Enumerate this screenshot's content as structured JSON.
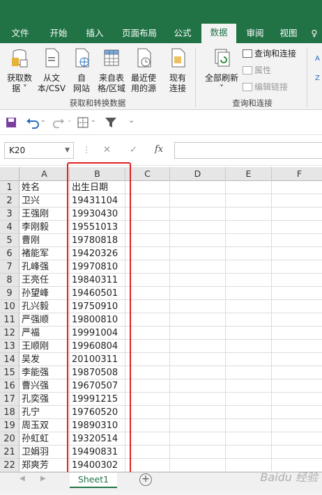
{
  "ribbon_tabs": [
    "文件",
    "开始",
    "插入",
    "页面布局",
    "公式",
    "数据",
    "审阅",
    "视图"
  ],
  "active_tab": "数据",
  "ribbon": {
    "get_data_label_line1": "获取数",
    "get_data_label_line2": "据 ˅",
    "from_text_line1": "从文",
    "from_text_line2": "本/CSV",
    "from_web_line1": "自",
    "from_web_line2": "网站",
    "from_table_line1": "来自表",
    "from_table_line2": "格/区域",
    "recent_sources_line1": "最近使",
    "recent_sources_line2": "用的源",
    "existing_conn_line1": "现有",
    "existing_conn_line2": "连接",
    "group1_label": "获取和转换数据",
    "refresh_all_line1": "全部刷新",
    "refresh_all_line2": "˅",
    "queries_connections": "查询和连接",
    "properties": "属性",
    "edit_links": "编辑链接",
    "group2_label": "查询和连接"
  },
  "namebox": {
    "value": "K20",
    "dropdown": "▼"
  },
  "formula_bar": {
    "cancel": "✕",
    "enter": "✓",
    "fx": "fx",
    "content": ""
  },
  "columns": [
    "A",
    "B",
    "C",
    "D",
    "E",
    "F"
  ],
  "rows": [
    {
      "n": "1",
      "a": "姓名",
      "b": "出生日期"
    },
    {
      "n": "2",
      "a": "卫兴",
      "b": "19431104"
    },
    {
      "n": "3",
      "a": "王强刚",
      "b": "19930430"
    },
    {
      "n": "4",
      "a": "李刚毅",
      "b": "19551013"
    },
    {
      "n": "5",
      "a": "曹刚",
      "b": "19780818"
    },
    {
      "n": "6",
      "a": "褚能军",
      "b": "19420326"
    },
    {
      "n": "7",
      "a": "孔峰强",
      "b": "19970810"
    },
    {
      "n": "8",
      "a": "王亮任",
      "b": "19840311"
    },
    {
      "n": "9",
      "a": "孙望峰",
      "b": "19460501"
    },
    {
      "n": "10",
      "a": "孔兴毅",
      "b": "19750910"
    },
    {
      "n": "11",
      "a": "严强顺",
      "b": "19800810"
    },
    {
      "n": "12",
      "a": "严福",
      "b": "19991004"
    },
    {
      "n": "13",
      "a": "王顺刚",
      "b": "19960804"
    },
    {
      "n": "14",
      "a": "吴发",
      "b": "20100311"
    },
    {
      "n": "15",
      "a": "李能强",
      "b": "19870508"
    },
    {
      "n": "16",
      "a": "曹兴强",
      "b": "19670507"
    },
    {
      "n": "17",
      "a": "孔奕强",
      "b": "19991215"
    },
    {
      "n": "18",
      "a": "孔宁",
      "b": "19760520"
    },
    {
      "n": "19",
      "a": "周玉双",
      "b": "19890310"
    },
    {
      "n": "20",
      "a": "孙虹虹",
      "b": "19320514"
    },
    {
      "n": "21",
      "a": "卫娟羽",
      "b": "19490831"
    },
    {
      "n": "22",
      "a": "郑爽芳",
      "b": "19400302"
    }
  ],
  "sheet_tab": "Sheet1",
  "add_sheet": "+",
  "watermark": "Baidu 经验",
  "colors": {
    "excel_green": "#217346",
    "highlight_red": "#e02020"
  }
}
